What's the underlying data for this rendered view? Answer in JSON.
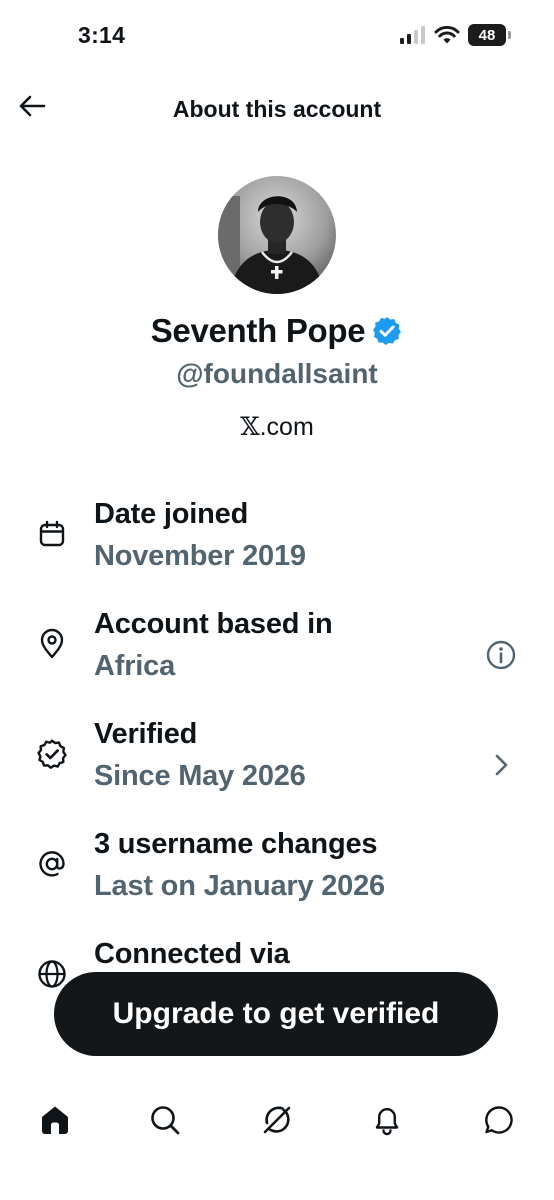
{
  "status_bar": {
    "time": "3:14",
    "battery_level": "48"
  },
  "header": {
    "title": "About this account"
  },
  "profile": {
    "display_name": "Seventh Pope",
    "handle": "@foundallsaint",
    "source_x": "𝕏",
    "source_domain": ".com"
  },
  "info_items": [
    {
      "label": "Date joined",
      "value": "November 2019",
      "icon": "calendar-icon"
    },
    {
      "label": "Account based in",
      "value": "Africa",
      "icon": "location-pin-icon",
      "action": "info-icon"
    },
    {
      "label": "Verified",
      "value": "Since May 2026",
      "icon": "verified-badge-icon",
      "action": "chevron-right-icon"
    },
    {
      "label": "3 username changes",
      "value": "Last on January 2026",
      "icon": "at-sign-icon"
    },
    {
      "label": "Connected via",
      "value": "",
      "icon": "globe-icon"
    }
  ],
  "cta": {
    "label": "Upgrade to get verified"
  },
  "tab_bar": [
    "home-icon",
    "search-icon",
    "grok-icon",
    "notifications-icon",
    "messages-icon"
  ],
  "colors": {
    "text": "#0f1419",
    "secondary": "#536471",
    "verified_blue": "#1d9bf0",
    "cta_bg": "#14171a"
  }
}
